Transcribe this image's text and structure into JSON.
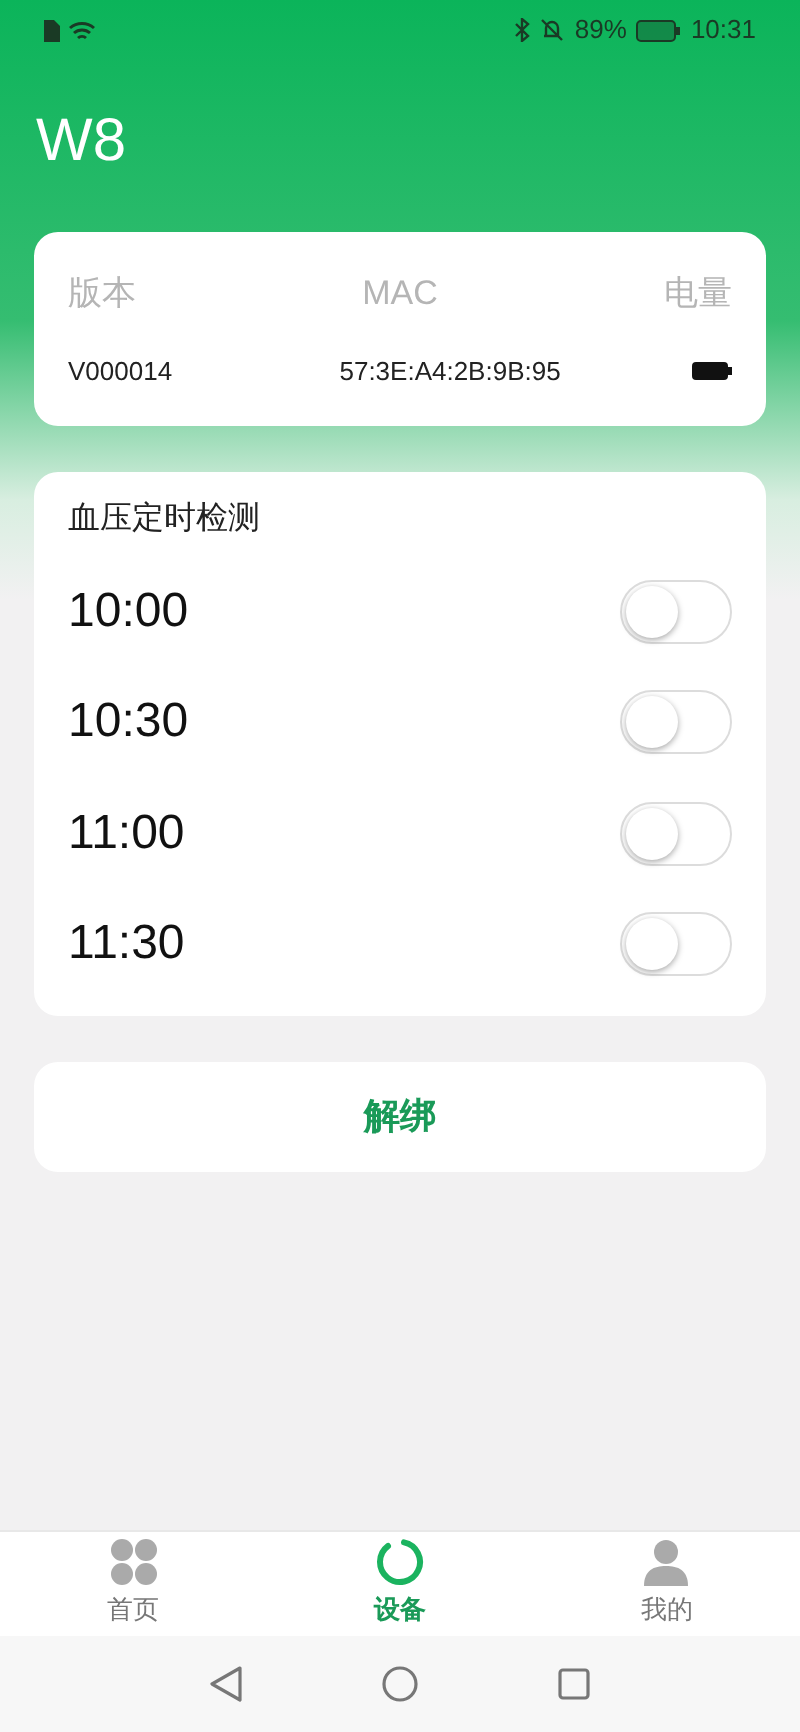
{
  "status_bar": {
    "battery": "89%",
    "time": "10:31"
  },
  "title": "W8",
  "device_info": {
    "columns": [
      "版本",
      "MAC",
      "电量"
    ],
    "version": "V000014",
    "mac": "57:3E:A4:2B:9B:95"
  },
  "schedule": {
    "title": "血压定时检测",
    "items": [
      {
        "time": "10:00",
        "on": false
      },
      {
        "time": "10:30",
        "on": false
      },
      {
        "time": "11:00",
        "on": false
      },
      {
        "time": "11:30",
        "on": false
      }
    ]
  },
  "unbind_button": "解绑",
  "tabs": [
    {
      "label": "首页",
      "kind": "home",
      "selected": false
    },
    {
      "label": "设备",
      "kind": "device",
      "selected": true
    },
    {
      "label": "我的",
      "kind": "profile",
      "selected": false
    }
  ]
}
